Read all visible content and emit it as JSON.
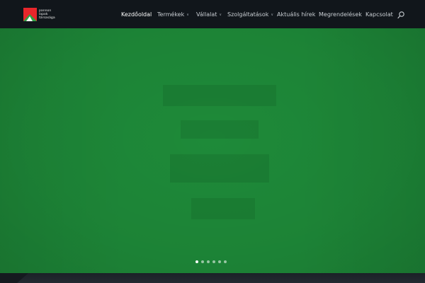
{
  "brand": {
    "logo_text": "pannon\nlapok\ntársasága",
    "colors": {
      "red": "#e8262b",
      "green": "#2ea043",
      "white": "#ffffff"
    }
  },
  "nav": {
    "items": [
      {
        "label": "Kezdőoldal",
        "dropdown": false,
        "active": true
      },
      {
        "label": "Termékek",
        "dropdown": true,
        "active": false
      },
      {
        "label": "Vállalat",
        "dropdown": true,
        "active": false
      },
      {
        "label": "Szolgáltatások",
        "dropdown": true,
        "active": false
      },
      {
        "label": "Aktuális hírek",
        "dropdown": false,
        "active": false
      },
      {
        "label": "Megrendelések",
        "dropdown": false,
        "active": false
      },
      {
        "label": "Kapcsolat",
        "dropdown": false,
        "active": false
      }
    ],
    "caret_glyph": "∨",
    "search_icon": "search-icon"
  },
  "hero": {
    "background_color": "#1e8a39"
  },
  "slider": {
    "slide_count": 6,
    "active_index": 0
  },
  "theme": {
    "header_bg": "#11161b",
    "footer_bg": "#1b2127"
  }
}
